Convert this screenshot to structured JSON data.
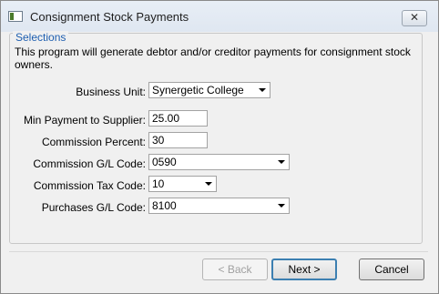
{
  "window": {
    "title": "Consignment Stock Payments",
    "close_glyph": "✕"
  },
  "group": {
    "legend": "Selections",
    "description": "This program will generate debtor and/or creditor payments for consignment stock owners."
  },
  "fields": {
    "business_unit": {
      "label": "Business Unit:",
      "value": "Synergetic College"
    },
    "min_payment": {
      "label": "Min Payment to Supplier:",
      "value": "25.00"
    },
    "commission_percent": {
      "label": "Commission Percent:",
      "value": "30"
    },
    "commission_gl": {
      "label": "Commission G/L Code:",
      "value": "0590"
    },
    "commission_tax": {
      "label": "Commission Tax Code:",
      "value": "10"
    },
    "purchases_gl": {
      "label": "Purchases G/L Code:",
      "value": "8100"
    }
  },
  "buttons": {
    "back": "< Back",
    "next": "Next >",
    "cancel": "Cancel"
  },
  "icons": {
    "app": "app-window-icon",
    "close": "close-icon",
    "dropdown": "chevron-down-icon"
  }
}
